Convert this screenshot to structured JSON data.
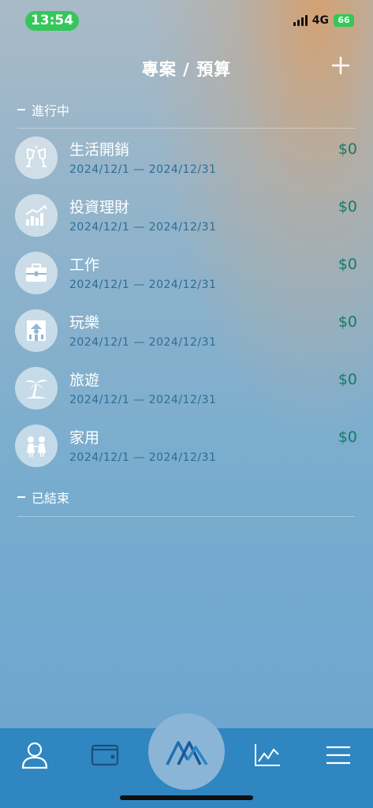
{
  "status_bar": {
    "time": "13:54",
    "network": "4G",
    "battery": "66"
  },
  "header": {
    "title": "專案 / 預算",
    "add_icon": "plus-icon"
  },
  "sections": {
    "active": "進行中",
    "ended": "已結束"
  },
  "projects": [
    {
      "name": "生活開銷",
      "start": "2024/12/1",
      "end": "2024/12/31",
      "amount": "$0",
      "icon": "toast-glasses-icon"
    },
    {
      "name": "投資理財",
      "start": "2024/12/1",
      "end": "2024/12/31",
      "amount": "$0",
      "icon": "growth-chart-icon"
    },
    {
      "name": "工作",
      "start": "2024/12/1",
      "end": "2024/12/31",
      "amount": "$0",
      "icon": "briefcase-icon"
    },
    {
      "name": "玩樂",
      "start": "2024/12/1",
      "end": "2024/12/31",
      "amount": "$0",
      "icon": "amusement-icon"
    },
    {
      "name": "旅遊",
      "start": "2024/12/1",
      "end": "2024/12/31",
      "amount": "$0",
      "icon": "palm-tree-icon"
    },
    {
      "name": "家用",
      "start": "2024/12/1",
      "end": "2024/12/31",
      "amount": "$0",
      "icon": "family-icon"
    }
  ],
  "date_separator": "—",
  "tabbar": {
    "items": [
      "profile-icon",
      "wallet-icon",
      "mountain-logo-icon",
      "chart-icon",
      "menu-icon"
    ]
  },
  "colors": {
    "amount": "#167a6a",
    "date": "#2d6d95",
    "tabbar": "#2f86c1",
    "time_pill": "#34c759"
  }
}
